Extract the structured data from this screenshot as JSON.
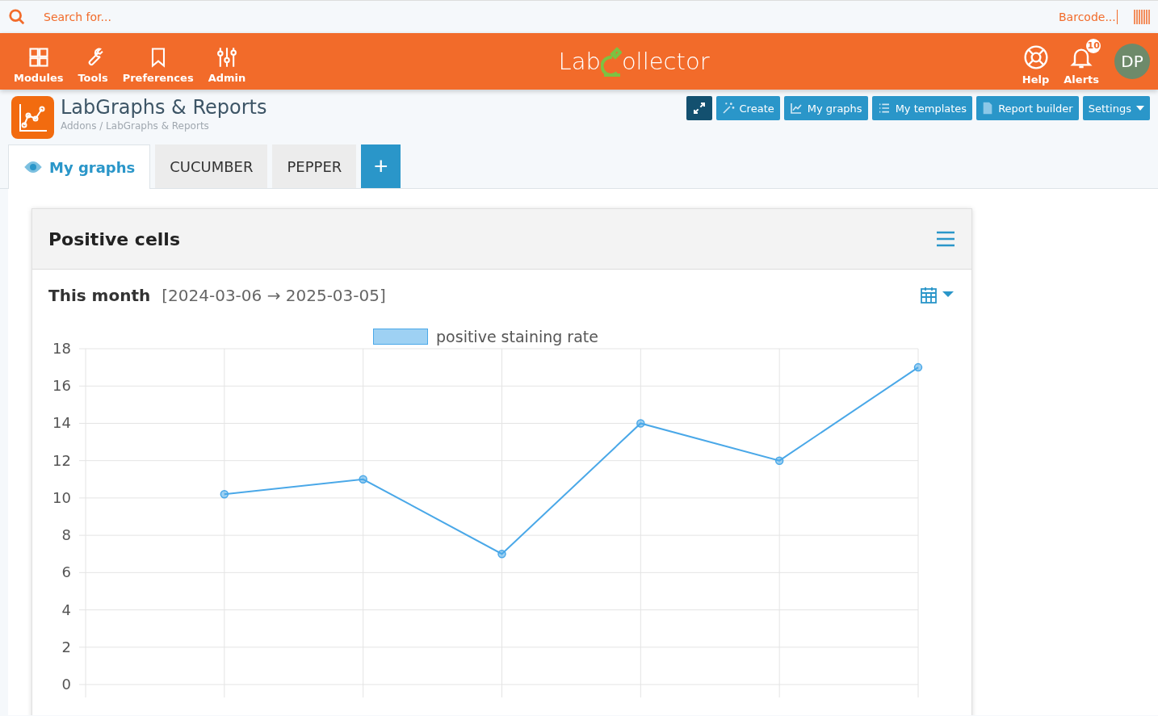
{
  "search": {
    "placeholder": "Search for..."
  },
  "barcode": {
    "placeholder": "Barcode..."
  },
  "nav": [
    {
      "label": "Modules",
      "kind": "grid"
    },
    {
      "label": "Tools",
      "kind": "wrench"
    },
    {
      "label": "Preferences",
      "kind": "bookmark"
    },
    {
      "label": "Admin",
      "kind": "sliders"
    }
  ],
  "logo": {
    "before": "Lab",
    "after": "ollector"
  },
  "right_nav": [
    {
      "label": "Help",
      "kind": "help"
    },
    {
      "label": "Alerts",
      "kind": "bell",
      "badge": "10"
    }
  ],
  "avatar": "DP",
  "page": {
    "title": "LabGraphs & Reports",
    "breadcrumb": "Addons / LabGraphs & Reports"
  },
  "actions": [
    {
      "kind": "expand"
    },
    {
      "label": "Create",
      "kind": "wand"
    },
    {
      "label": "My graphs",
      "kind": "chart"
    },
    {
      "label": "My templates",
      "kind": "list"
    },
    {
      "label": "Report builder",
      "kind": "file"
    },
    {
      "label": "Settings",
      "kind": "dropdown"
    }
  ],
  "tabs": [
    {
      "label": "My graphs",
      "selected": true
    },
    {
      "label": "CUCUMBER",
      "selected": false
    },
    {
      "label": "PEPPER",
      "selected": false
    }
  ],
  "add_tab": "+",
  "card": {
    "title": "Positive cells",
    "period": "This month",
    "range": "[2024-03-06 → 2025-03-05]",
    "chart_data": {
      "type": "line",
      "categories": [
        null,
        null,
        null,
        null,
        null,
        null
      ],
      "ylim": [
        0,
        18
      ],
      "grid": true,
      "yticks": [
        0,
        2,
        4,
        6,
        8,
        10,
        12,
        14,
        16,
        18
      ],
      "series": [
        {
          "name": "positive staining rate",
          "color": "#4aa8e8",
          "marker": "circle",
          "values": [
            10.2,
            11,
            7,
            14,
            12,
            17
          ]
        }
      ]
    }
  }
}
